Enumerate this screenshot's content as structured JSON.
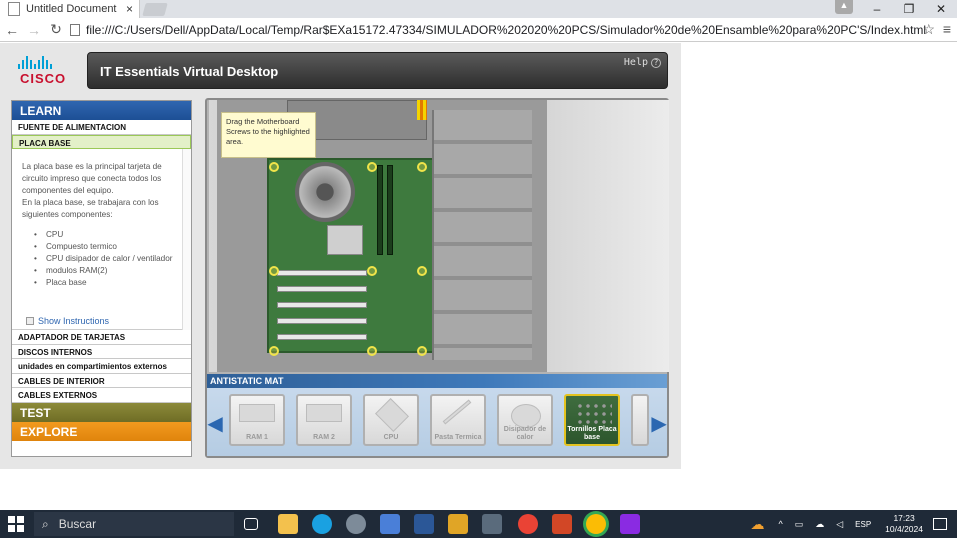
{
  "browser": {
    "tab_title": "Untitled Document",
    "tab_close": "×",
    "url": "file:///C:/Users/Dell/AppData/Local/Temp/Rar$EXa15172.47334/SIMULADOR%202020%20PCS/Simulador%20de%20Ensamble%20para%20PC'S/Index.html",
    "win_minimize": "–",
    "win_restore": "❐",
    "win_close": "✕"
  },
  "app": {
    "logo_text": "CISCO",
    "title": "IT Essentials Virtual Desktop",
    "help": "Help",
    "help_icon_glyph": "?"
  },
  "sidebar": {
    "learn": "LEARN",
    "items_top": [
      {
        "label": "FUENTE DE ALIMENTACION"
      },
      {
        "label": "PLACA BASE"
      }
    ],
    "description": {
      "p1": "La placa base es la principal tarjeta de circuito impreso que conecta todos los componentes del equipo.",
      "p2": "En la placa base, se trabajara con los siguientes componentes:",
      "components": [
        "CPU",
        "Compuesto termico",
        "CPU disipador de calor / ventilador",
        "modulos RAM(2)",
        "Placa base"
      ]
    },
    "show_instructions": "Show Instructions",
    "items_bottom": [
      {
        "label": "ADAPTADOR DE TARJETAS"
      },
      {
        "label": "DISCOS INTERNOS"
      },
      {
        "label": "unidades en compartimientos externos"
      },
      {
        "label": "CABLES DE INTERIOR"
      },
      {
        "label": "CABLES EXTERNOS"
      }
    ],
    "test": "TEST",
    "explore": "EXPLORE"
  },
  "workspace": {
    "tooltip": "Drag the Motherboard Screws to the highlighted area.",
    "mat_label": "ANTISTATIC MAT",
    "items": [
      {
        "label": "RAM 1"
      },
      {
        "label": "RAM 2"
      },
      {
        "label": "CPU"
      },
      {
        "label": "Pasta Termica"
      },
      {
        "label": "Disipador de calor"
      },
      {
        "label": "Tornillos Placa base"
      }
    ]
  },
  "taskbar": {
    "search_placeholder": "Buscar",
    "lang": "ESP",
    "time": "17:23",
    "date": "10/4/2024"
  },
  "colors": {
    "learn": "#1d4f95",
    "test": "#6f6d25",
    "explore": "#e0840c",
    "active_item": "#e3f0c8",
    "selected_tray_border": "#e4c320"
  }
}
